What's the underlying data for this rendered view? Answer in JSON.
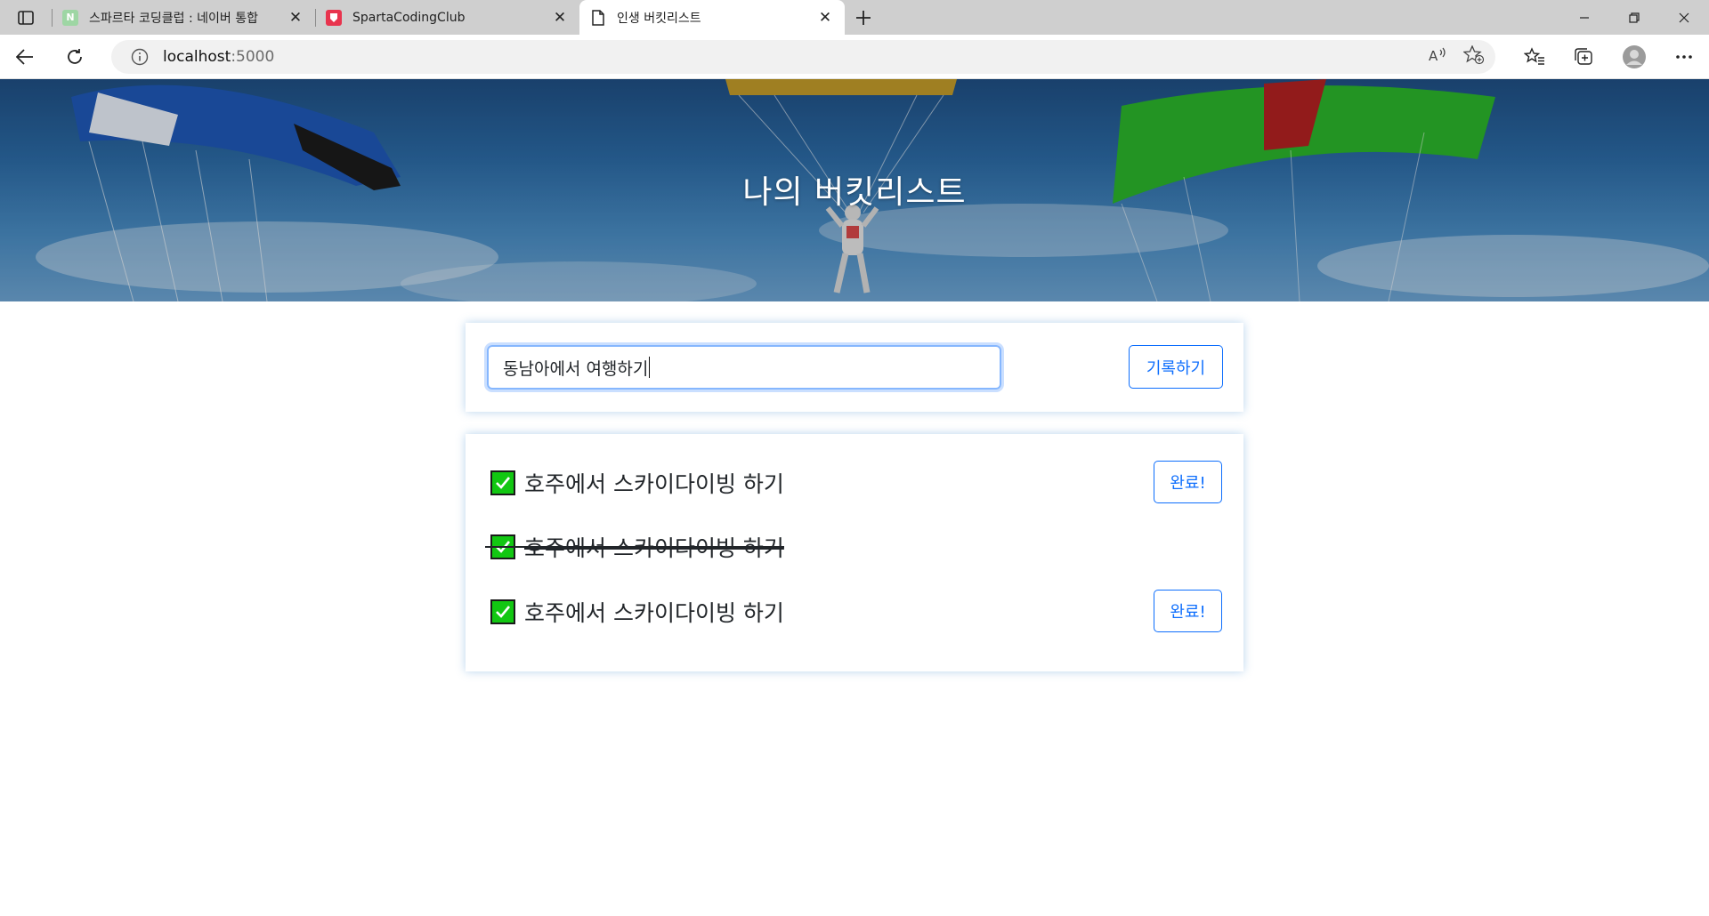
{
  "browser": {
    "tabs": [
      {
        "title": "스파르타 코딩클럽 : 네이버 통합",
        "favicon": "N",
        "active": false
      },
      {
        "title": "SpartaCodingClub",
        "favicon": "sparta-logo",
        "active": false
      },
      {
        "title": "인생 버킷리스트",
        "favicon": "page-icon",
        "active": true
      }
    ],
    "url_host": "localhost",
    "url_port": ":5000"
  },
  "hero": {
    "title": "나의 버킷리스트"
  },
  "form": {
    "input_value": "동남아에서 여행하기",
    "save_label": "기록하기"
  },
  "bucket": {
    "items": [
      {
        "text": "호주에서 스카이다이빙 하기",
        "done": false,
        "button": "완료!"
      },
      {
        "text": "호주에서 스카이다이빙 하기",
        "done": true
      },
      {
        "text": "호주에서 스카이다이빙 하기",
        "done": false,
        "button": "완료!"
      }
    ]
  },
  "colors": {
    "accent": "#0d6efd",
    "check": "#12c712"
  }
}
